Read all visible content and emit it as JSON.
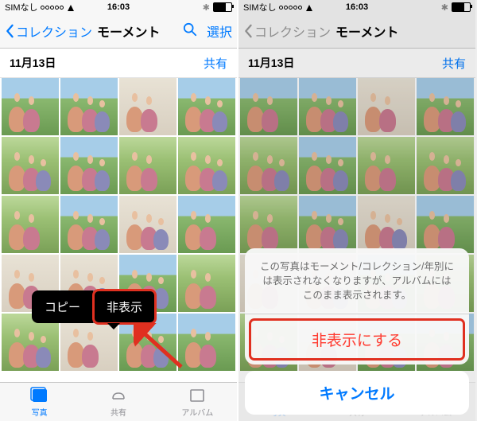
{
  "status": {
    "carrier": "SIMなし",
    "time": "16:03"
  },
  "nav": {
    "back_label": "コレクション",
    "title": "モーメント",
    "select": "選択"
  },
  "section": {
    "date": "11月13日",
    "share": "共有"
  },
  "bubble": {
    "copy": "コピー",
    "hide": "非表示"
  },
  "sheet": {
    "message": "この写真はモーメント/コレクション/年別には表示されなくなりますが、アルバムにはこのまま表示されます。",
    "hide_action": "非表示にする",
    "cancel": "キャンセル"
  },
  "tabs": {
    "photos": "写真",
    "shared": "共有",
    "albums": "アルバム"
  }
}
